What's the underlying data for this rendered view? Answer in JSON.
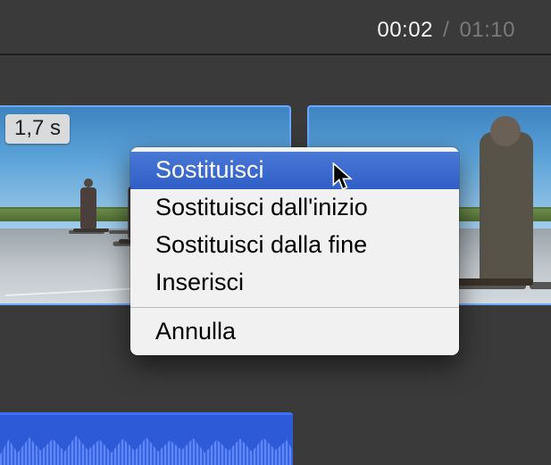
{
  "playhead": {
    "current": "00:02",
    "separator": "/",
    "total": "01:10"
  },
  "clip": {
    "duration_badge": "1,7 s"
  },
  "context_menu": {
    "items": [
      {
        "label": "Sostituisci",
        "highlighted": true
      },
      {
        "label": "Sostituisci dall'inizio",
        "highlighted": false
      },
      {
        "label": "Sostituisci dalla fine",
        "highlighted": false
      },
      {
        "label": "Inserisci",
        "highlighted": false
      }
    ],
    "cancel": "Annulla"
  }
}
